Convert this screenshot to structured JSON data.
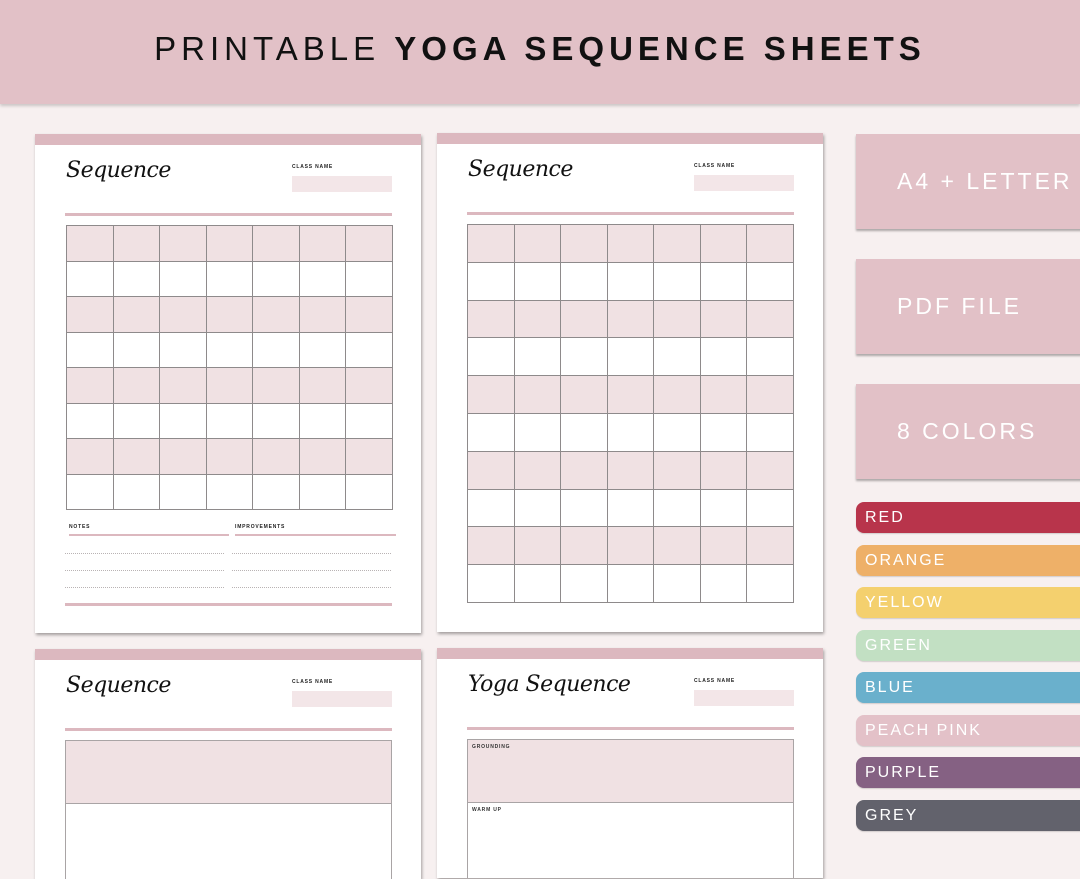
{
  "banner": {
    "title_light": "PRINTABLE",
    "title_bold": "YOGA SEQUENCE SHEETS"
  },
  "colors": {
    "banner_bg": "#e2c1c7",
    "accent_pink": "#dcb8bf",
    "row_shade": "#f0e1e3",
    "page_bg": "#f7f0f0"
  },
  "sheets": [
    {
      "title": "Sequence",
      "class_name_label": "CLASS NAME",
      "grid": {
        "columns": 7,
        "rows": 8,
        "shaded_rows": [
          0,
          2,
          4,
          6
        ]
      },
      "notes_label": "NOTES",
      "improvements_label": "IMPROVEMENTS"
    },
    {
      "title": "Sequence",
      "class_name_label": "CLASS NAME",
      "grid": {
        "columns": 7,
        "rows": 10,
        "shaded_rows": [
          0,
          2,
          4,
          6,
          8
        ]
      }
    },
    {
      "title": "Sequence",
      "class_name_label": "CLASS NAME"
    },
    {
      "title": "Yoga Sequence",
      "class_name_label": "CLASS NAME",
      "sections": [
        "GROUNDING",
        "WARM UP"
      ]
    }
  ],
  "features": [
    {
      "label": "A4 + LETTER"
    },
    {
      "label": "PDF FILE"
    },
    {
      "label": "8 COLORS"
    }
  ],
  "color_options": [
    {
      "label": "RED",
      "color": "#b8344b"
    },
    {
      "label": "ORANGE",
      "color": "#eeb068"
    },
    {
      "label": "YELLOW",
      "color": "#f4d06e"
    },
    {
      "label": "GREEN",
      "color": "#c2e0c3"
    },
    {
      "label": "BLUE",
      "color": "#6ab0cc"
    },
    {
      "label": "PEACH PINK",
      "color": "#e3c1c8"
    },
    {
      "label": "PURPLE",
      "color": "#856183"
    },
    {
      "label": "GREY",
      "color": "#62626c"
    }
  ]
}
